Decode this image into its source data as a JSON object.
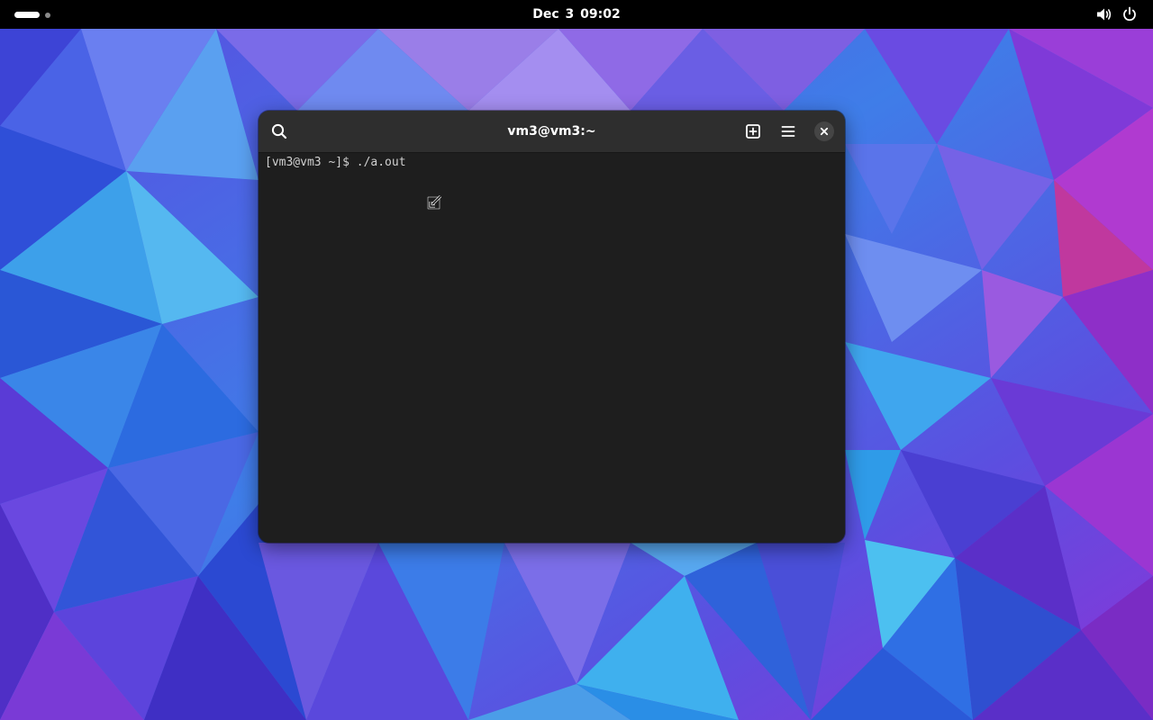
{
  "topbar": {
    "date": "Dec 3",
    "time": "09:02",
    "icons": [
      "workspace-indicator",
      "volume-icon",
      "power-icon"
    ]
  },
  "terminal": {
    "title": "vm3@vm3:~",
    "prompt": "[vm3@vm3 ~]$ ",
    "command": "./a.out",
    "icons": [
      "search-icon",
      "new-tab-icon",
      "hamburger-menu-icon",
      "close-icon"
    ]
  },
  "colors": {
    "topbar": "#000000",
    "headerbar": "#2e2e2e",
    "terminal_bg": "#1e1e1e",
    "terminal_text": "#d0d0d0",
    "wallpaper_purple": "#7b3fe4",
    "wallpaper_blue": "#2f6fe6"
  }
}
